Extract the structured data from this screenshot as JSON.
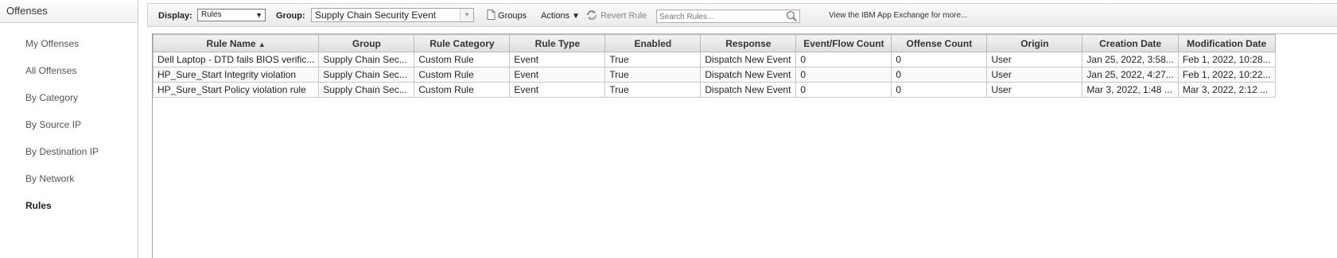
{
  "sidebar": {
    "title": "Offenses",
    "items": [
      {
        "label": "My Offenses"
      },
      {
        "label": "All Offenses"
      },
      {
        "label": "By Category"
      },
      {
        "label": "By Source IP"
      },
      {
        "label": "By Destination IP"
      },
      {
        "label": "By Network"
      },
      {
        "label": "Rules",
        "active": true
      }
    ]
  },
  "toolbar": {
    "display_label": "Display:",
    "display_value": "Rules",
    "group_label": "Group:",
    "group_value": "Supply Chain Security Event",
    "groups_button": "Groups",
    "actions_button": "Actions",
    "revert_rule_button": "Revert Rule",
    "search_placeholder": "Search Rules...",
    "app_exchange_link": "View the IBM App Exchange for more..."
  },
  "table": {
    "columns": [
      "Rule Name",
      "Group",
      "Rule Category",
      "Rule Type",
      "Enabled",
      "Response",
      "Event/Flow Count",
      "Offense Count",
      "Origin",
      "Creation Date",
      "Modification Date"
    ],
    "sorted_column": "Rule Name",
    "rows": [
      [
        "Dell Laptop - DTD fails BIOS verific...",
        "Supply Chain Sec...",
        "Custom Rule",
        "Event",
        "True",
        "Dispatch New Event",
        "0",
        "0",
        "User",
        "Jan 25, 2022, 3:58...",
        "Feb 1, 2022, 10:28..."
      ],
      [
        "HP_Sure_Start Integrity violation",
        "Supply Chain Sec...",
        "Custom Rule",
        "Event",
        "True",
        "Dispatch New Event",
        "0",
        "0",
        "User",
        "Jan 25, 2022, 4:27...",
        "Feb 1, 2022, 10:22..."
      ],
      [
        "HP_Sure_Start Policy violation rule",
        "Supply Chain Sec...",
        "Custom Rule",
        "Event",
        "True",
        "Dispatch New Event",
        "0",
        "0",
        "User",
        "Mar 3, 2022, 1:48 ...",
        "Mar 3, 2022, 2:12 ..."
      ]
    ]
  }
}
